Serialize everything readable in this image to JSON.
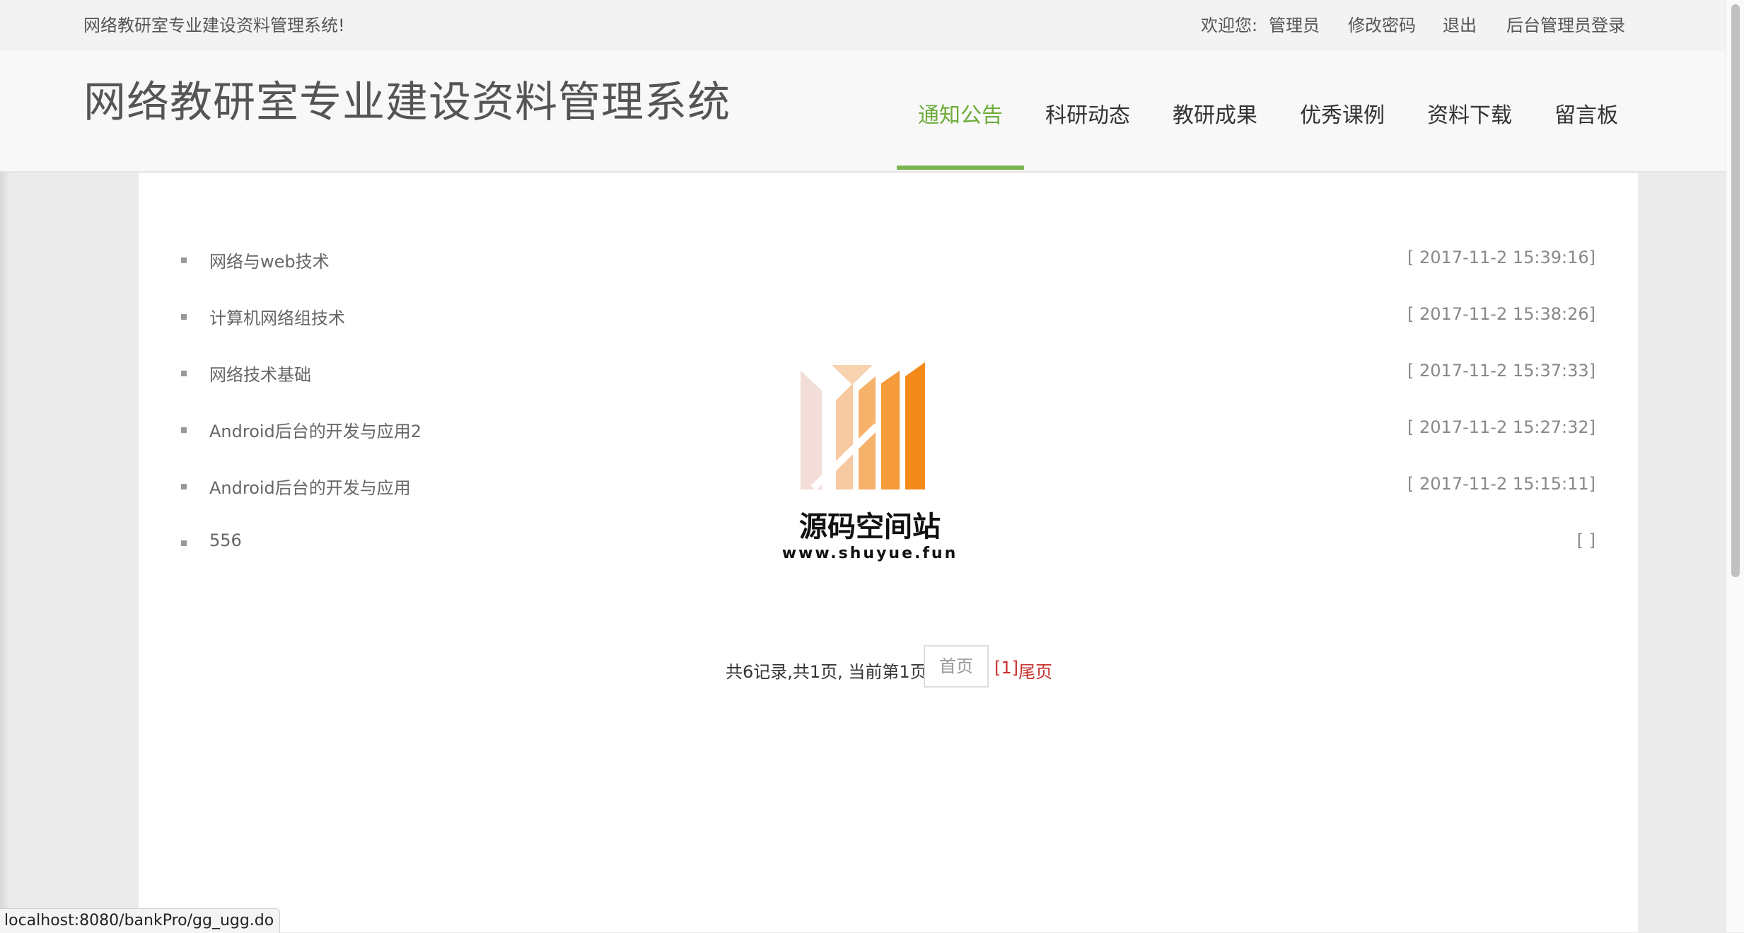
{
  "topbar": {
    "site_name": "网络教研室专业建设资料管理系统!",
    "welcome": "欢迎您:",
    "user": "管理员",
    "change_password": "修改密码",
    "logout": "退出",
    "admin_login": "后台管理员登录"
  },
  "header": {
    "title": "网络教研室专业建设资料管理系统",
    "nav": [
      {
        "label": "通知公告",
        "active": true
      },
      {
        "label": "科研动态",
        "active": false
      },
      {
        "label": "教研成果",
        "active": false
      },
      {
        "label": "优秀课例",
        "active": false
      },
      {
        "label": "资料下载",
        "active": false
      },
      {
        "label": "留言板",
        "active": false
      }
    ]
  },
  "notices": [
    {
      "title": "网络与web技术",
      "date": "[ 2017-11-2 15:39:16]"
    },
    {
      "title": "计算机网络组技术",
      "date": "[ 2017-11-2 15:38:26]"
    },
    {
      "title": "网络技术基础",
      "date": "[ 2017-11-2 15:37:33]"
    },
    {
      "title": "Android后台的开发与应用2",
      "date": "[ 2017-11-2 15:27:32]"
    },
    {
      "title": "Android后台的开发与应用",
      "date": "[ 2017-11-2 15:15:11]"
    },
    {
      "title": "556",
      "date": "[ ]"
    }
  ],
  "pager": {
    "summary": "共6记录,共1页, 当前第1页",
    "first": "首页",
    "current": "[1]",
    "last": "尾页"
  },
  "watermark": {
    "name": "源码空间站",
    "url": "www.shuyue.fun"
  },
  "status_url": "localhost:8080/bankPro/gg_ugg.do",
  "colors": {
    "accent_green": "#6dad3a",
    "pager_red": "#c8302c",
    "logo_orange": "#f38a1a"
  }
}
